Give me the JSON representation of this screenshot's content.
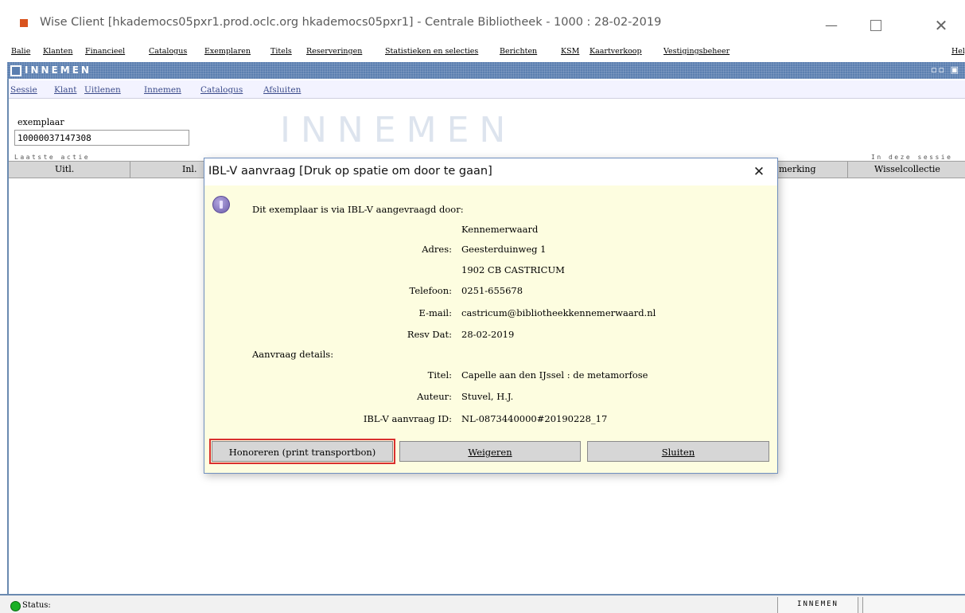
{
  "window": {
    "title": "Wise Client [hkademocs05pxr1.prod.oclc.org hkademocs05pxr1] - Centrale Bibliotheek - 1000 : 28-02-2019",
    "min_symbol": "—",
    "close_symbol": "✕"
  },
  "menubar": [
    "Balie",
    "Klanten",
    "Financieel",
    "Catalogus",
    "Exemplaren",
    "Titels",
    "Reserveringen",
    "Statistieken en selecties",
    "Berichten",
    "KSM",
    "Kaartverkoop",
    "Vestigingsbeheer"
  ],
  "menubar_help": "Help",
  "inner": {
    "title": "INNEMEN",
    "controls": "▫▫ ▣",
    "submenu": [
      "Sessie",
      "Klant",
      "Uitlenen",
      "Innemen",
      "Catalogus",
      "Afsluiten"
    ],
    "exemplaar_label": "exemplaar",
    "exemplaar_value": "10000037147308",
    "watermark": "INNEMEN",
    "laatste_actie": "Laatste actie",
    "in_deze_sessie": "In deze sessie",
    "columns": [
      "Uitl.",
      "Inl.",
      "merking",
      "Wisselcollectie"
    ]
  },
  "status": {
    "label": "Status:",
    "panel": "INNEMEN",
    "indicator_color": "#19b025"
  },
  "dialog": {
    "title": "IBL-V aanvraag [Druk op spatie om door te gaan]",
    "close": "✕",
    "intro": "Dit exemplaar is via IBL-V aangevraagd door:",
    "name": "Kennemerwaard",
    "adres_label": "Adres:",
    "adres_1": "Geesterduinweg 1",
    "adres_2": "1902 CB CASTRICUM",
    "telefoon_label": "Telefoon:",
    "telefoon": "0251-655678",
    "email_label": "E-mail:",
    "email": "castricum@bibliotheekkennemerwaard.nl",
    "resv_label": "Resv Dat:",
    "resv": "28-02-2019",
    "details_title": "Aanvraag details:",
    "titel_label": "Titel:",
    "titel": "Capelle aan den IJssel : de metamorfose",
    "auteur_label": "Auteur:",
    "auteur": "Stuvel, H.J.",
    "id_label": "IBL-V aanvraag ID:",
    "id": "NL-0873440000#20190228_17",
    "buttons": {
      "honoreren": "Honoreren (print transportbon)",
      "weigeren": "Weigeren",
      "sluiten": "Sluiten"
    },
    "highlight_color": "#d9302e"
  }
}
